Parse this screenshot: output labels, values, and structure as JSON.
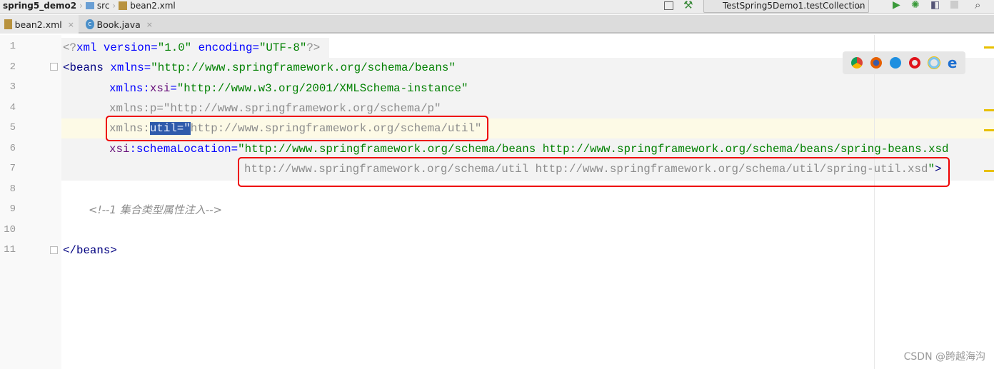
{
  "breadcrumb": [
    "spring5_demo2",
    "src",
    "bean2.xml"
  ],
  "run_config": "TestSpring5Demo1.testCollection",
  "tabs": [
    {
      "label": "bean2.xml",
      "active": true
    },
    {
      "label": "Book.java",
      "active": false
    }
  ],
  "line_numbers": [
    "1",
    "2",
    "3",
    "4",
    "5",
    "6",
    "7",
    "8",
    "9",
    "10",
    "11"
  ],
  "code": {
    "l1": {
      "a": "<?",
      "b": "xml",
      "c": " version=",
      "d": "\"1.0\"",
      "e": " encoding=",
      "f": "\"UTF-8\"",
      "g": "?>"
    },
    "l2": {
      "a": "<",
      "b": "beans",
      "c": " xmlns=",
      "d": "\"http://www.springframework.org/schema/beans\""
    },
    "l3": {
      "a": "xmlns:",
      "b": "xsi",
      "c": "=",
      "d": "\"http://www.w3.org/2001/XMLSchema-instance\""
    },
    "l4": "xmlns:p=\"http://www.springframework.org/schema/p\"",
    "l5": {
      "a": "xmlns:",
      "sel": "util=\"",
      "b": "http://www.springframework.org/schema/util\""
    },
    "l6": {
      "a": "xsi",
      "b": ":schemaLocation=",
      "c": "\"http://www.springframework.org/schema/beans http://www.springframework.org/schema/beans/spring-beans.xsd"
    },
    "l7": {
      "a": "http://www.springframework.org/schema/util http://www.springframework.org/schema/util/spring-util.xsd",
      "b": "\"",
      "c": ">"
    },
    "l9": "<!--1 集合类型属性注入-->",
    "l11": {
      "a": "</",
      "b": "beans",
      "c": ">"
    }
  },
  "browser_icons": [
    "chrome-icon",
    "firefox-icon",
    "safari-icon",
    "opera-icon",
    "ie-icon",
    "edge-icon"
  ],
  "colors": {
    "selection": "#2f5bab",
    "highlight_box": "#e00000",
    "tag": "#000080",
    "attribute": "#0000ff",
    "value": "#008000"
  },
  "watermark": "CSDN @跨越海沟"
}
